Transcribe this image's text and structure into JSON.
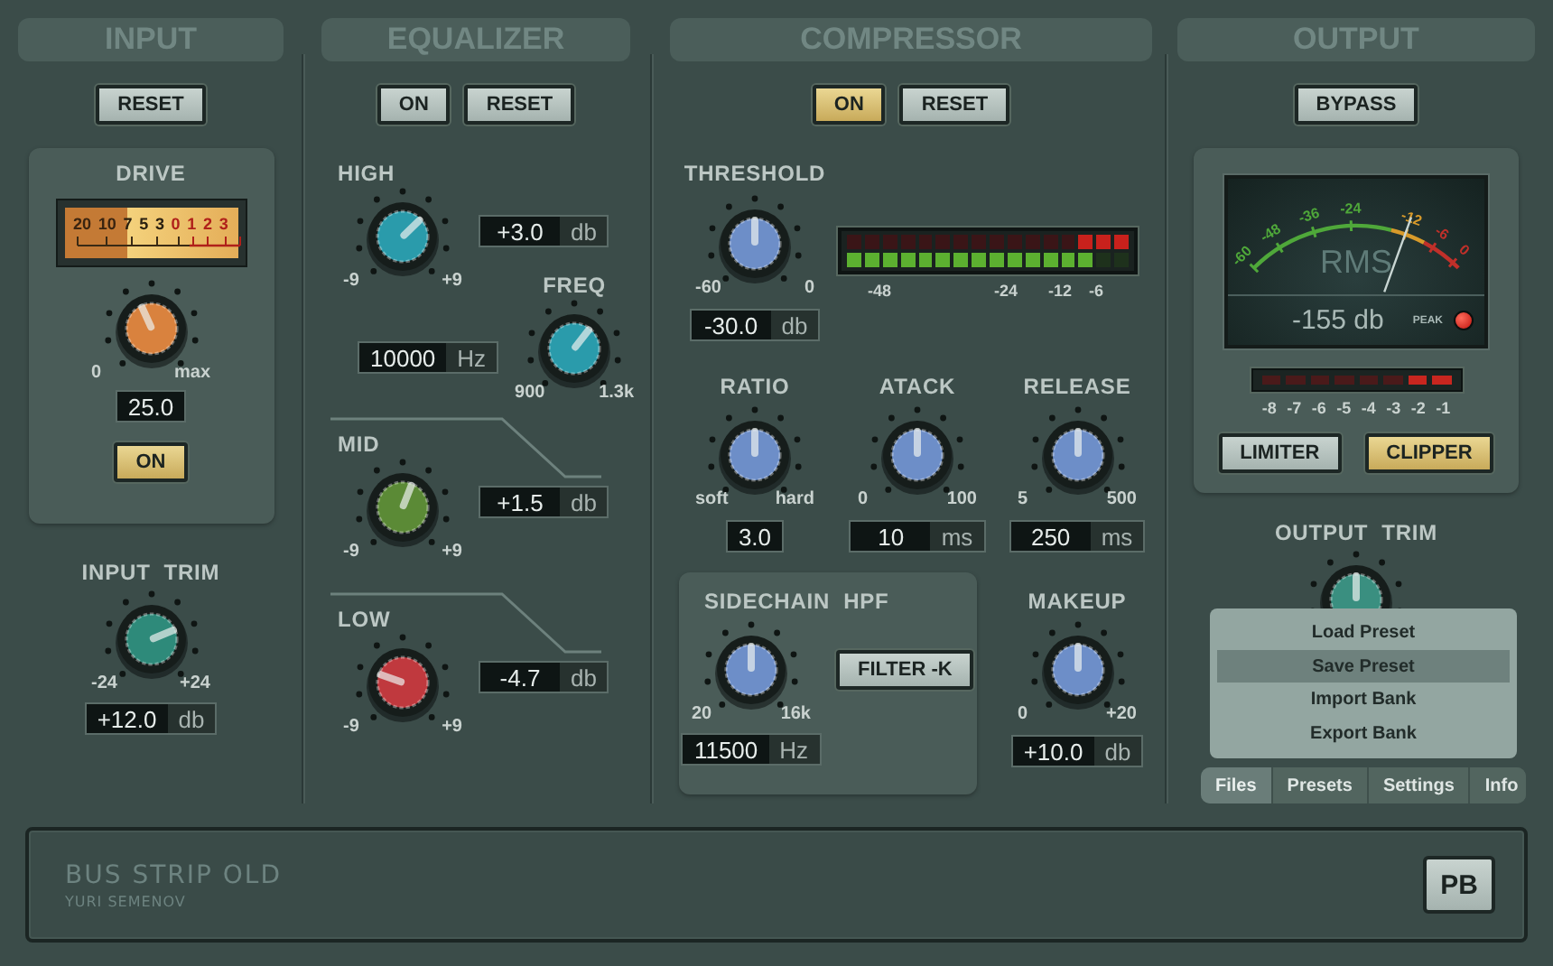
{
  "input": {
    "title": "INPUT",
    "reset": {
      "label": "RESET",
      "on": false
    },
    "drive": {
      "label": "DRIVE",
      "vu_scale": [
        {
          "text": "20",
          "color": "#3a2410"
        },
        {
          "text": "10",
          "color": "#3a2410"
        },
        {
          "text": "7",
          "color": "#2a2010"
        },
        {
          "text": "5",
          "color": "#2a2010"
        },
        {
          "text": "3",
          "color": "#2a2010"
        },
        {
          "text": "0",
          "color": "#b0201a"
        },
        {
          "text": "1",
          "color": "#b0201a"
        },
        {
          "text": "2",
          "color": "#b0201a"
        },
        {
          "text": "3",
          "color": "#b0201a"
        }
      ],
      "knob": {
        "level": 0.41,
        "color": "#d9823e",
        "min": "0",
        "max": "max"
      },
      "value": "25.0",
      "button": {
        "label": "ON",
        "on": true
      }
    },
    "trim": {
      "label": "INPUT  TRIM",
      "knob": {
        "level": 0.75,
        "color": "#2e8a7a",
        "min": "-24",
        "max": "+24"
      },
      "value": "+12.0",
      "unit": "db"
    }
  },
  "equalizer": {
    "title": "EQUALIZER",
    "buttons": [
      {
        "label": "ON",
        "on": false
      },
      {
        "label": "RESET",
        "on": false
      }
    ],
    "bands": [
      {
        "kind": "gain",
        "label": "HIGH",
        "knob": {
          "level": 0.67,
          "color": "#2a9bab",
          "min": "-9",
          "max": "+9"
        },
        "value": "+3.0",
        "unit": "db"
      },
      {
        "kind": "freq",
        "label": "FREQ",
        "knob": {
          "level": 0.64,
          "color": "#2a9bab",
          "min": "900",
          "max": "1.3k"
        },
        "value": "10000",
        "unit": "Hz"
      },
      {
        "kind": "gain",
        "label": "MID",
        "knob": {
          "level": 0.58,
          "color": "#5b8a36",
          "min": "-9",
          "max": "+9"
        },
        "value": "+1.5",
        "unit": "db"
      },
      {
        "kind": "gain",
        "label": "LOW",
        "knob": {
          "level": 0.24,
          "color": "#c0393e",
          "min": "-9",
          "max": "+9"
        },
        "value": "-4.7",
        "unit": "db"
      }
    ]
  },
  "compressor": {
    "title": "COMPRESSOR",
    "buttons": [
      {
        "label": "ON",
        "on": true
      },
      {
        "label": "RESET",
        "on": false
      }
    ],
    "threshold": {
      "label": "THRESHOLD",
      "knob": {
        "level": 0.5,
        "color": "#6d8ec8",
        "min": "-60",
        "max": "0"
      },
      "value": "-30.0",
      "unit": "db"
    },
    "meter": {
      "rows": [
        {
          "kind": "reduction",
          "level": 0.19
        },
        {
          "kind": "input",
          "level": 0.875
        }
      ],
      "scale": [
        "-48",
        "-24",
        "-12",
        "-6"
      ]
    },
    "controls": [
      {
        "label": "RATIO",
        "knob": {
          "level": 0.5,
          "color": "#6d8ec8",
          "min": "soft",
          "max": "hard"
        },
        "value": "3.0"
      },
      {
        "label": "ATACK",
        "knob": {
          "level": 0.5,
          "color": "#6d8ec8",
          "min": "0",
          "max": "100"
        },
        "value": "10",
        "unit": "ms"
      },
      {
        "label": "RELEASE",
        "knob": {
          "level": 0.5,
          "color": "#6d8ec8",
          "min": "5",
          "max": "500"
        },
        "value": "250",
        "unit": "ms"
      }
    ],
    "sidechain": {
      "label": "SIDECHAIN  HPF",
      "knob": {
        "level": 0.5,
        "color": "#6d8ec8",
        "min": "20",
        "max": "16k"
      },
      "value": "11500",
      "unit": "Hz",
      "button": {
        "label": "FILTER -K",
        "on": false
      }
    },
    "makeup": {
      "label": "MAKEUP",
      "knob": {
        "level": 0.5,
        "color": "#6d8ec8",
        "min": "0",
        "max": "+20"
      },
      "value": "+10.0",
      "unit": "db"
    }
  },
  "output": {
    "title": "OUTPUT",
    "bypass": {
      "label": "BYPASS",
      "on": false
    },
    "rms_meter": {
      "scale": [
        {
          "text": "-60",
          "color": "#4fa83a"
        },
        {
          "text": "-48",
          "color": "#4fa83a"
        },
        {
          "text": "-36",
          "color": "#4fa83a"
        },
        {
          "text": "-24",
          "color": "#4fa83a"
        },
        {
          "text": "-12",
          "color": "#d89a2a"
        },
        {
          "text": "-6",
          "color": "#c0302a"
        },
        {
          "text": "0",
          "color": "#c0302a"
        }
      ],
      "watermark": "RMS",
      "level": 0.72,
      "reading": "-155 db",
      "peak_label": "PEAK",
      "peak_on": true
    },
    "clip_meter": {
      "level": 0.25,
      "scale": [
        "-8",
        "-7",
        "-6",
        "-5",
        "-4",
        "-3",
        "-2",
        "-1"
      ]
    },
    "buttons": [
      {
        "label": "LIMITER",
        "on": false
      },
      {
        "label": "CLIPPER",
        "on": true
      }
    ],
    "trim": {
      "label": "OUTPUT  TRIM",
      "knob": {
        "level": 0.5,
        "color": "#3a8f80"
      }
    },
    "menu": [
      {
        "label": "Load Preset",
        "selected": false
      },
      {
        "label": "Save Preset",
        "selected": true
      },
      {
        "label": "Import Bank",
        "selected": false
      },
      {
        "label": "Export Bank",
        "selected": false
      }
    ],
    "tabs": [
      {
        "label": "Files",
        "selected": true
      },
      {
        "label": "Presets",
        "selected": false
      },
      {
        "label": "Settings",
        "selected": false
      },
      {
        "label": "Info",
        "selected": false
      }
    ]
  },
  "footer": {
    "title": "BUS STRIP OLD",
    "author": "YURI SEMENOV",
    "button": "PB"
  }
}
